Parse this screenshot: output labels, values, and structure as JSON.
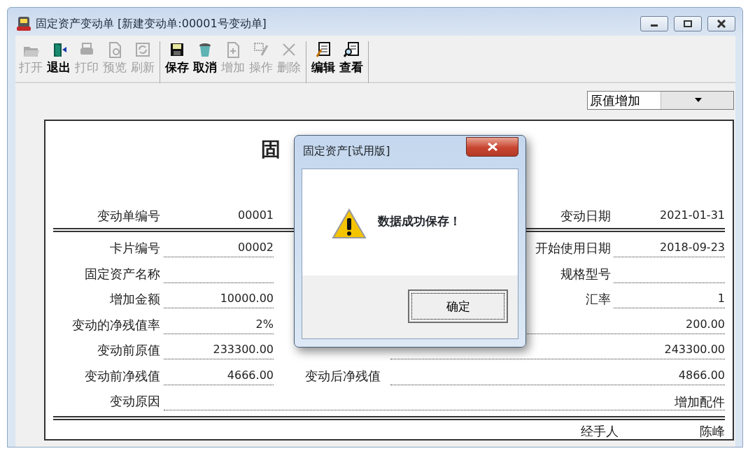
{
  "window": {
    "title": "固定资产变动单 [新建变动单:00001号变动单]"
  },
  "toolbar": {
    "groups": [
      [
        {
          "label": "打开",
          "kind": "folder",
          "disabled": true
        },
        {
          "label": "退出",
          "kind": "door",
          "disabled": false
        },
        {
          "label": "打印",
          "kind": "printer",
          "disabled": true
        },
        {
          "label": "预览",
          "kind": "preview",
          "disabled": true
        },
        {
          "label": "刷新",
          "kind": "refresh",
          "disabled": true
        }
      ],
      [
        {
          "label": "保存",
          "kind": "floppy",
          "disabled": false
        },
        {
          "label": "取消",
          "kind": "bin",
          "disabled": false
        },
        {
          "label": "增加",
          "kind": "addpage",
          "disabled": true
        },
        {
          "label": "操作",
          "kind": "gridpen",
          "disabled": true
        },
        {
          "label": "删除",
          "kind": "cross",
          "disabled": true
        }
      ],
      [
        {
          "label": "编辑",
          "kind": "formpen",
          "disabled": false
        },
        {
          "label": "查看",
          "kind": "formlens",
          "disabled": false
        }
      ]
    ]
  },
  "change_type": {
    "value": "原值增加"
  },
  "form": {
    "title": "固",
    "header": {
      "left": {
        "label": "变动单编号",
        "value": "00001"
      },
      "right": {
        "label": "变动日期",
        "value": "2021-01-31"
      }
    },
    "rows": [
      {
        "left": {
          "label": "卡片编号",
          "value": "00002"
        },
        "right": {
          "kind": "short",
          "label": "开始使用日期",
          "value": "2018-09-23"
        }
      },
      {
        "left": {
          "label": "固定资产名称"
        },
        "right": {
          "kind": "short",
          "label": "规格型号"
        }
      },
      {
        "left": {
          "label": "增加金额",
          "value": "10000.00"
        },
        "right": {
          "kind": "short",
          "label": "汇率",
          "value": "1"
        }
      },
      {
        "left": {
          "label": "变动的净残值率",
          "value": "2%"
        },
        "right": {
          "kind": "long",
          "value": "200.00"
        }
      },
      {
        "left": {
          "label": "变动前原值",
          "value": "233300.00"
        },
        "right": {
          "kind": "long",
          "value": "243300.00"
        }
      },
      {
        "left": {
          "label": "变动前净残值",
          "value": "4666.00"
        },
        "right": {
          "kind": "long",
          "label": "变动后净残值",
          "value": "4866.00"
        }
      }
    ],
    "reason": {
      "label": "变动原因",
      "value": "增加配件"
    },
    "footer": {
      "label": "经手人",
      "value": "陈峰"
    }
  },
  "dialog": {
    "title": "固定资产[试用版]",
    "message": "数据成功保存！",
    "button": "确定"
  }
}
